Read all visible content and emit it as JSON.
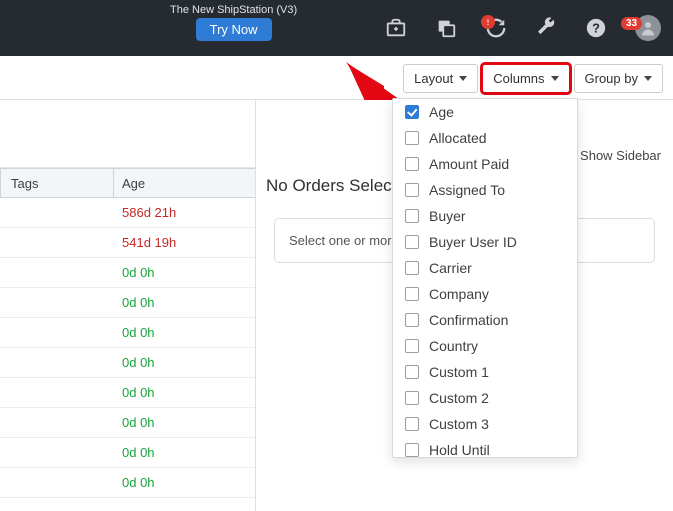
{
  "promo": {
    "text": "The New ShipStation (V3)",
    "button": "Try Now"
  },
  "topbar": {
    "badge_count": "33"
  },
  "toolbar": {
    "layout": "Layout",
    "columns": "Columns",
    "groupby": "Group by"
  },
  "sidebar_link": "Show Sidebar",
  "right": {
    "title": "No Orders Selected",
    "hint": "Select one or more orders to see order properties"
  },
  "grid": {
    "headers": {
      "tags": "Tags",
      "age": "Age"
    },
    "rows": [
      {
        "age": "586d 21h",
        "cls": "age-red"
      },
      {
        "age": "541d 19h",
        "cls": "age-red"
      },
      {
        "age": "0d 0h",
        "cls": "age-green"
      },
      {
        "age": "0d 0h",
        "cls": "age-green"
      },
      {
        "age": "0d 0h",
        "cls": "age-green"
      },
      {
        "age": "0d 0h",
        "cls": "age-green"
      },
      {
        "age": "0d 0h",
        "cls": "age-green"
      },
      {
        "age": "0d 0h",
        "cls": "age-green"
      },
      {
        "age": "0d 0h",
        "cls": "age-green"
      },
      {
        "age": "0d 0h",
        "cls": "age-green"
      }
    ]
  },
  "columns_menu": [
    {
      "label": "Age",
      "checked": true
    },
    {
      "label": "Allocated",
      "checked": false
    },
    {
      "label": "Amount Paid",
      "checked": false
    },
    {
      "label": "Assigned To",
      "checked": false
    },
    {
      "label": "Buyer",
      "checked": false
    },
    {
      "label": "Buyer User ID",
      "checked": false
    },
    {
      "label": "Carrier",
      "checked": false
    },
    {
      "label": "Company",
      "checked": false
    },
    {
      "label": "Confirmation",
      "checked": false
    },
    {
      "label": "Country",
      "checked": false
    },
    {
      "label": "Custom 1",
      "checked": false
    },
    {
      "label": "Custom 2",
      "checked": false
    },
    {
      "label": "Custom 3",
      "checked": false
    },
    {
      "label": "Hold Until",
      "checked": false
    }
  ]
}
